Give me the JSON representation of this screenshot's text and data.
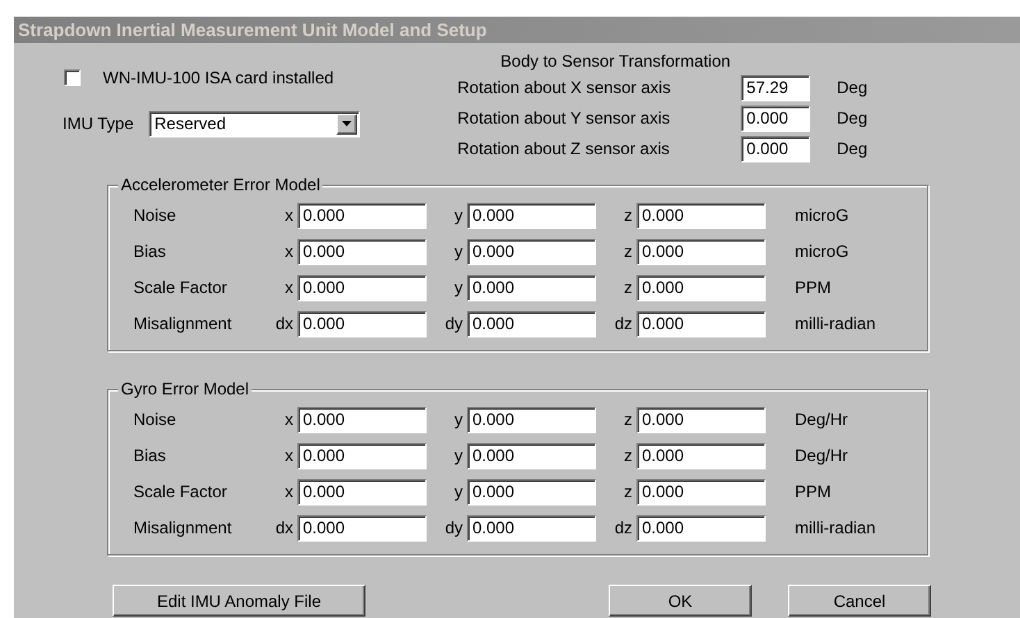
{
  "window": {
    "title": "Strapdown Inertial Measurement Unit Model and Setup"
  },
  "isa_card": {
    "label": "WN-IMU-100 ISA card installed",
    "checked": false
  },
  "imu_type": {
    "label": "IMU Type",
    "value": "Reserved"
  },
  "transformation": {
    "title": "Body to Sensor Transformation",
    "rows": [
      {
        "label": "Rotation about X sensor axis",
        "value": "57.29",
        "unit": "Deg"
      },
      {
        "label": "Rotation about Y sensor axis",
        "value": "0.000",
        "unit": "Deg"
      },
      {
        "label": "Rotation about Z sensor axis",
        "value": "0.000",
        "unit": "Deg"
      }
    ]
  },
  "groups": [
    {
      "title": "Accelerometer Error Model",
      "rows": [
        {
          "label": "Noise",
          "fields": [
            {
              "axis": "x",
              "value": "0.000"
            },
            {
              "axis": "y",
              "value": "0.000"
            },
            {
              "axis": "z",
              "value": "0.000"
            }
          ],
          "unit": "microG"
        },
        {
          "label": "Bias",
          "fields": [
            {
              "axis": "x",
              "value": "0.000"
            },
            {
              "axis": "y",
              "value": "0.000"
            },
            {
              "axis": "z",
              "value": "0.000"
            }
          ],
          "unit": "microG"
        },
        {
          "label": "Scale Factor",
          "fields": [
            {
              "axis": "x",
              "value": "0.000"
            },
            {
              "axis": "y",
              "value": "0.000"
            },
            {
              "axis": "z",
              "value": "0.000"
            }
          ],
          "unit": "PPM"
        },
        {
          "label": "Misalignment",
          "fields": [
            {
              "axis": "dx",
              "value": "0.000"
            },
            {
              "axis": "dy",
              "value": "0.000"
            },
            {
              "axis": "dz",
              "value": "0.000"
            }
          ],
          "unit": "milli-radian"
        }
      ]
    },
    {
      "title": "Gyro Error Model",
      "rows": [
        {
          "label": "Noise",
          "fields": [
            {
              "axis": "x",
              "value": "0.000"
            },
            {
              "axis": "y",
              "value": "0.000"
            },
            {
              "axis": "z",
              "value": "0.000"
            }
          ],
          "unit": "Deg/Hr"
        },
        {
          "label": "Bias",
          "fields": [
            {
              "axis": "x",
              "value": "0.000"
            },
            {
              "axis": "y",
              "value": "0.000"
            },
            {
              "axis": "z",
              "value": "0.000"
            }
          ],
          "unit": "Deg/Hr"
        },
        {
          "label": "Scale Factor",
          "fields": [
            {
              "axis": "x",
              "value": "0.000"
            },
            {
              "axis": "y",
              "value": "0.000"
            },
            {
              "axis": "z",
              "value": "0.000"
            }
          ],
          "unit": "PPM"
        },
        {
          "label": "Misalignment",
          "fields": [
            {
              "axis": "dx",
              "value": "0.000"
            },
            {
              "axis": "dy",
              "value": "0.000"
            },
            {
              "axis": "dz",
              "value": "0.000"
            }
          ],
          "unit": "milli-radian"
        }
      ]
    }
  ],
  "buttons": [
    {
      "label": "Edit IMU Anomaly File"
    },
    {
      "label": "OK"
    },
    {
      "label": "Cancel"
    }
  ]
}
